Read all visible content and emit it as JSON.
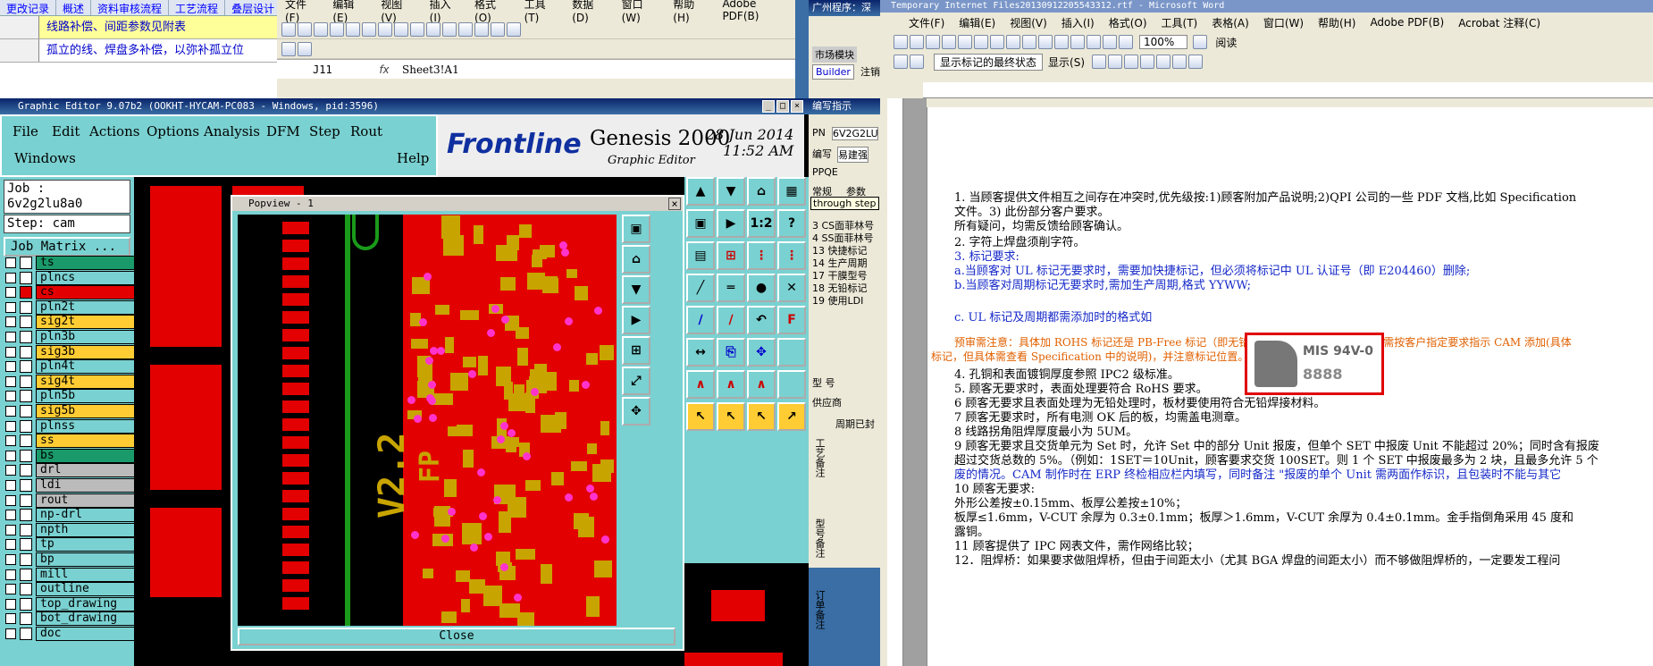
{
  "excel_left": {
    "tabs": [
      "更改记录",
      "概述",
      "资料审核流程",
      "工艺流程",
      "叠层设计"
    ],
    "rows": [
      "线路补偿、间距参数见附表",
      "孤立的线、焊盘多补偿，以弥补孤立位"
    ]
  },
  "excel_mid": {
    "menu": [
      "文件(F)",
      "编辑(E)",
      "视图(V)",
      "插入(I)",
      "格式(O)",
      "工具(T)",
      "数据(D)",
      "窗口(W)",
      "帮助(H)",
      "Adobe PDF(B)"
    ],
    "name_box": "J11",
    "fx": "fx",
    "formula": "Sheet3!A1"
  },
  "genesis": {
    "window_title": "Graphic Editor 9.07b2 (OOKHT-HYCAM-PC083 - Windows, pid:3596)",
    "menu": [
      "File",
      "Edit",
      "Actions",
      "Options",
      "Analysis",
      "DFM",
      "Step",
      "Rout",
      "Windows",
      "Help"
    ],
    "brand": "Frontline",
    "product": "Genesis 2000",
    "subtitle": "Graphic Editor",
    "date": "28 Jun 2014",
    "time": "11:52 AM",
    "job": "Job : 6v2g2lu8a0",
    "step": "Step: cam",
    "job_matrix": "Job Matrix ...",
    "layers": [
      {
        "name": "ts",
        "color": "#1a9a6a"
      },
      {
        "name": "plncs",
        "color": "#7ad1d1"
      },
      {
        "name": "cs",
        "color": "#e20000",
        "active": true
      },
      {
        "name": "pln2t",
        "color": "#7ad1d1"
      },
      {
        "name": "sig2t",
        "color": "#ffcc33"
      },
      {
        "name": "pln3b",
        "color": "#7ad1d1"
      },
      {
        "name": "sig3b",
        "color": "#ffcc33"
      },
      {
        "name": "pln4t",
        "color": "#7ad1d1"
      },
      {
        "name": "sig4t",
        "color": "#ffcc33"
      },
      {
        "name": "pln5b",
        "color": "#7ad1d1"
      },
      {
        "name": "sig5b",
        "color": "#ffcc33"
      },
      {
        "name": "plnss",
        "color": "#7ad1d1"
      },
      {
        "name": "ss",
        "color": "#ffcc33"
      },
      {
        "name": "bs",
        "color": "#1a9a6a"
      },
      {
        "name": "drl",
        "color": "#bbbbbb"
      },
      {
        "name": "ldi",
        "color": "#bbbbbb"
      },
      {
        "name": "rout",
        "color": "#bbbbbb"
      },
      {
        "name": "np-drl",
        "color": "#7ad1d1"
      },
      {
        "name": "npth",
        "color": "#7ad1d1"
      },
      {
        "name": "tp",
        "color": "#7ad1d1"
      },
      {
        "name": "bp",
        "color": "#7ad1d1"
      },
      {
        "name": "mill",
        "color": "#7ad1d1"
      },
      {
        "name": "outline",
        "color": "#7ad1d1"
      },
      {
        "name": "top_drawing",
        "color": "#7ad1d1"
      },
      {
        "name": "bot_drawing",
        "color": "#7ad1d1"
      },
      {
        "name": "doc",
        "color": "#7ad1d1"
      }
    ],
    "popview_title": "Popview - 1",
    "popview_close": "Close",
    "silk_text_1": "V2.2",
    "silk_text_2": "FP",
    "tool_labels": [
      "1:2",
      "?"
    ]
  },
  "narrow_app": {
    "title": "广州程序：深",
    "tab": "市场模块",
    "sub_title": "编写指示",
    "fields": [
      "PN",
      "6V2G2LU",
      "编写",
      "易建强",
      "PPQE"
    ],
    "tabs2": [
      "常规",
      "参数"
    ],
    "tooltip": "through step",
    "list": [
      "3 CS面菲林号",
      "4 SS面菲林号",
      "13 快捷标记",
      "14 生产周期",
      "17 干膜型号",
      "18 无铅标记",
      "19 使用LDI"
    ],
    "labels": [
      "型 号",
      "供应商",
      "周期已封",
      "工艺备注",
      "型号备注",
      "订单备注"
    ],
    "builder": "Builder",
    "notes": "注销"
  },
  "word": {
    "title": "Temporary Internet Files20130912205543312.rtf - Microsoft Word",
    "menu": [
      "文件(F)",
      "编辑(E)",
      "视图(V)",
      "插入(I)",
      "格式(O)",
      "工具(T)",
      "表格(A)",
      "窗口(W)",
      "帮助(H)",
      "Adobe PDF(B)",
      "Acrobat 注释(C)"
    ],
    "zoom": "100%",
    "reading": "阅读",
    "track_label": "显示标记的最终状态",
    "show_label": "显示(S)",
    "paragraphs": [
      {
        "text": "1.  当顾客提供文件相互之间存在冲突时,优先级按:1)顾客附加产品说明;2)QPI 公司的一些 PDF 文档,比如 Specification",
        "style": "n"
      },
      {
        "text": "    文件。3) 此份部分客户要求。",
        "style": "n"
      },
      {
        "text": "    所有疑问，均需反馈给顾客确认。",
        "style": "n"
      },
      {
        "text": "2.  字符上焊盘须削字符。",
        "style": "n"
      },
      {
        "text": "3.  标记要求:",
        "style": "b"
      },
      {
        "text": "    a.当顾客对 UL 标记无要求时，需要加快捷标记，但必须将标记中 UL 认证号（即 E204460）删除;",
        "style": "b"
      },
      {
        "text": "    b.当顾客对周期标记无要求时,需加生产周期,格式 YYWW;",
        "style": "b"
      },
      {
        "text": "    c. UL 标记及周期都需添加时的格式如",
        "style": "b"
      },
      {
        "text": "    预审需注意：具体加 ROHS 标记还是 PB-Free 标记（即无铅标记），客户会有明确要求，需按客户指定要求指示 CAM 添加(具体",
        "style": "o"
      },
      {
        "text": "标记，但具体需查看 Specification 中的说明)，并注意标记位置。",
        "style": "o"
      },
      {
        "text": "4.  孔铜和表面镀铜厚度参照 IPC2 级标准。",
        "style": "n"
      },
      {
        "text": "5.  顾客无要求时，表面处理要符合 RoHS 要求。",
        "style": "n"
      },
      {
        "text": "6  顾客无要求且表面处理为无铅处理时，板材要使用符合无铅焊接材料。",
        "style": "n"
      },
      {
        "text": "7  顾客无要求时，所有电测 OK 后的板，均需盖电测章。",
        "style": "n"
      },
      {
        "text": "8  线路拐角阻焊厚度最小为 5UM。",
        "style": "n"
      },
      {
        "text": "9  顾客无要求且交货单元为 Set 时，允许 Set 中的部分 Unit 报废，但单个 SET 中报废 Unit 不能超过 20%；同时含有报废",
        "style": "n"
      },
      {
        "text": "超过交货总数的 5%。（例如：1SET＝10Unit，顾客要求交货 100SET。则 1 个 SET 中报废最多为 2 块，且最多允许 5 个",
        "style": "nb"
      },
      {
        "text": "废的情况。CAM 制作时在 ERP 终检相应栏内填写，同时备注 \"报废的单个 Unit 需两面作标识，且包装时不能与其它",
        "style": "b"
      },
      {
        "text": "10  顾客无要求:",
        "style": "n"
      },
      {
        "text": "    外形公差按±0.15mm、板厚公差按±10%；",
        "style": "n"
      },
      {
        "text": "    板厚≤1.6mm，V-CUT 余厚为 0.3±0.1mm；板厚＞1.6mm，V-CUT 余厚为 0.4±0.1mm。金手指倒角采用 45 度和",
        "style": "n"
      },
      {
        "text": "    露铜。",
        "style": "n"
      },
      {
        "text": "11  顾客提供了 IPC 网表文件，需作网络比较；",
        "style": "n"
      },
      {
        "text": "12．阻焊桥：如果要求做阻焊桥，但由于间距太小（尤其 BGA 焊盘的间距太小）而不够做阻焊桥的，一定要发工程问",
        "style": "n"
      }
    ],
    "stamp_text": "MIS 94V-0",
    "stamp_code": "8888"
  }
}
